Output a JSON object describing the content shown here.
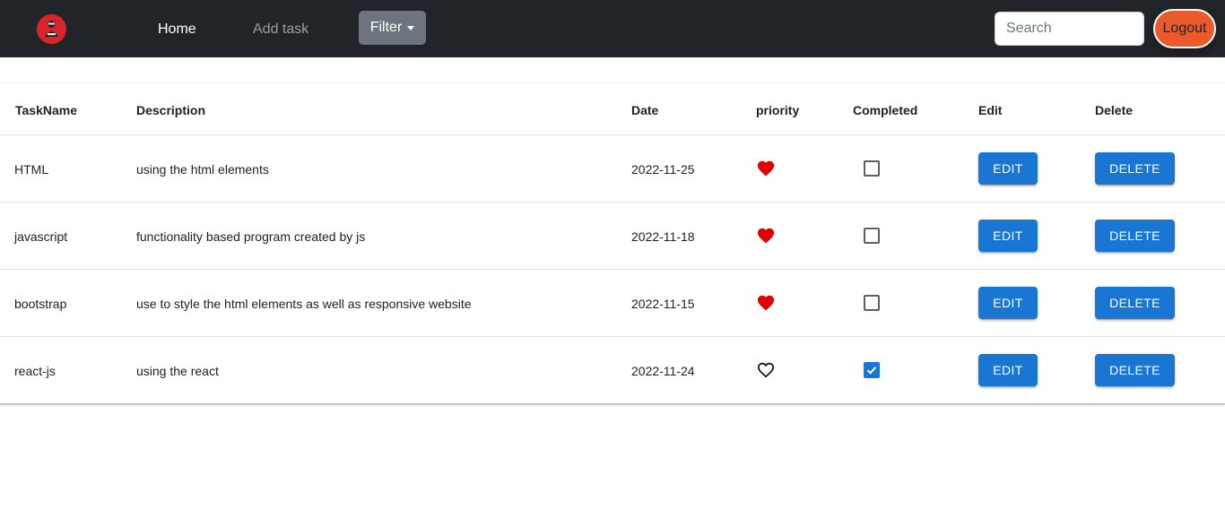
{
  "navbar": {
    "logo_icon": "avatar-logo-icon",
    "home_label": "Home",
    "add_task_label": "Add task",
    "filter_label": "Filter",
    "search_placeholder": "Search",
    "logout_label": "Logout"
  },
  "colors": {
    "navbar_bg": "#212529",
    "logout_bg": "#ea5a2b",
    "button_blue": "#1976d2",
    "heart_red": "#e00000"
  },
  "table": {
    "headers": {
      "taskname": "TaskName",
      "description": "Description",
      "date": "Date",
      "priority": "priority",
      "completed": "Completed",
      "edit": "Edit",
      "delete": "Delete"
    },
    "rows": [
      {
        "taskname": "HTML",
        "description": "using the html elements",
        "date": "2022-11-25",
        "priority": true,
        "completed": false,
        "edit_label": "EDIT",
        "delete_label": "DELETE"
      },
      {
        "taskname": "javascript",
        "description": "functionality based program created by js",
        "date": "2022-11-18",
        "priority": true,
        "completed": false,
        "edit_label": "EDIT",
        "delete_label": "DELETE"
      },
      {
        "taskname": "bootstrap",
        "description": "use to style the html elements as well as responsive website",
        "date": "2022-11-15",
        "priority": true,
        "completed": false,
        "edit_label": "EDIT",
        "delete_label": "DELETE"
      },
      {
        "taskname": "react-js",
        "description": "using the react",
        "date": "2022-11-24",
        "priority": false,
        "completed": true,
        "edit_label": "EDIT",
        "delete_label": "DELETE"
      }
    ]
  }
}
